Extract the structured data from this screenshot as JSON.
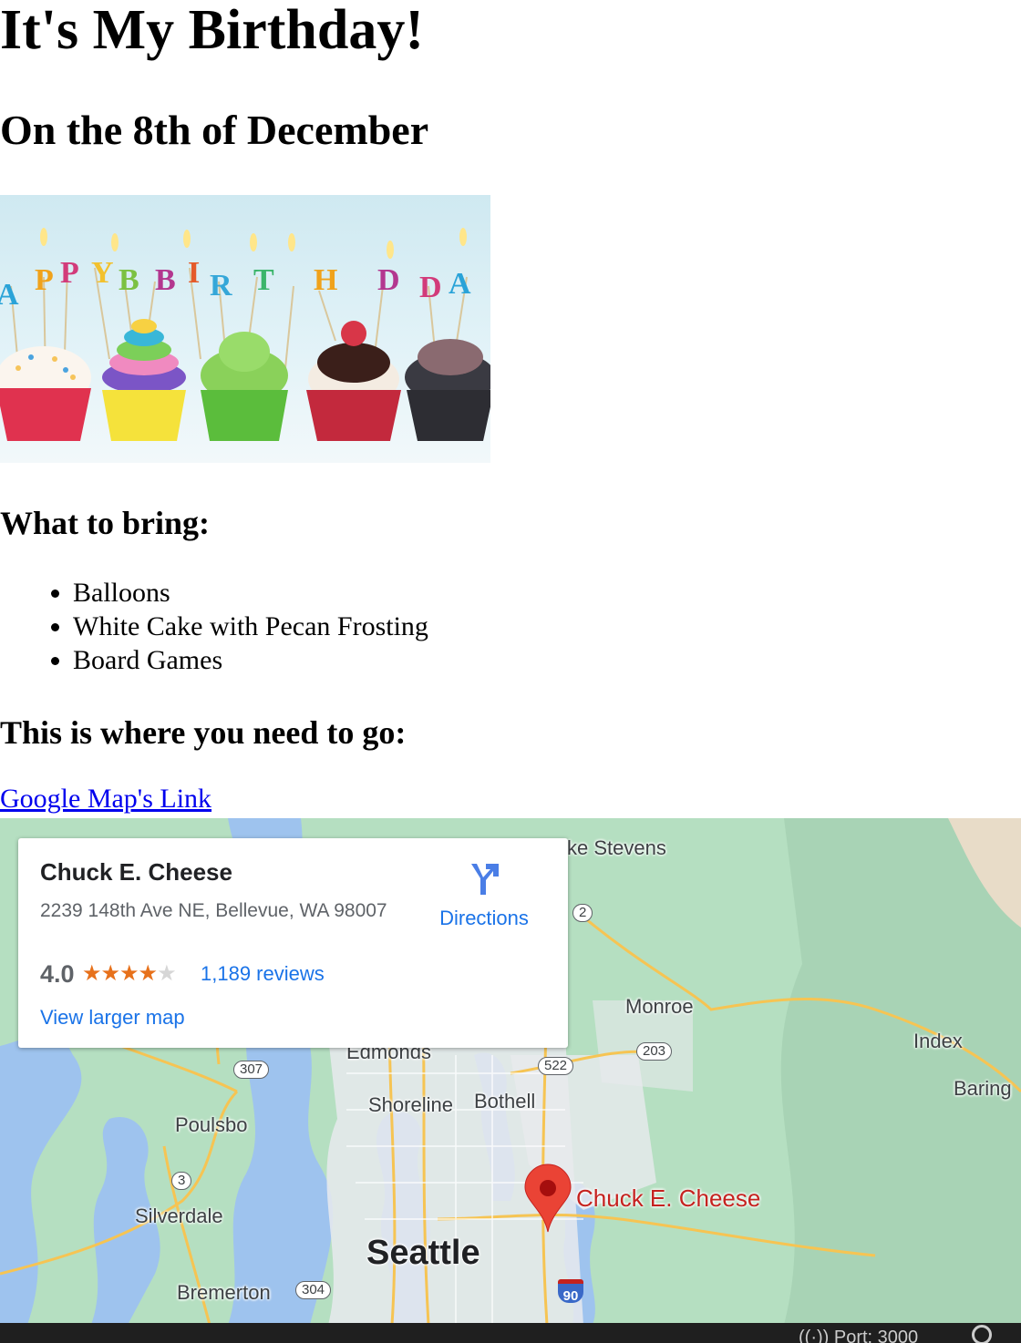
{
  "page": {
    "title": "It's My Birthday!",
    "date_heading": "On the 8th of December",
    "banner_text": "HAPPY BIRTHDAY",
    "bring_heading": "What to bring:",
    "bring_items": [
      "Balloons",
      "White Cake with Pecan Frosting",
      "Board Games"
    ],
    "where_heading": "This is where you need to go:",
    "map_link_label": "Google Map's Link"
  },
  "map_card": {
    "place_name": "Chuck E. Cheese",
    "address": "2239 148th Ave NE, Bellevue, WA 98007",
    "rating": "4.0",
    "stars_filled": 4,
    "stars_total": 5,
    "reviews": "1,189 reviews",
    "directions_label": "Directions",
    "view_larger": "View larger map",
    "directions_icon": "directions-arrow-icon",
    "star_color": "#e7711b",
    "link_color": "#1a73e8"
  },
  "map": {
    "cities": {
      "seattle": "Seattle",
      "monroe": "Monroe",
      "index": "Index",
      "baring": "Baring",
      "edmonds": "Edmonds",
      "shoreline": "Shoreline",
      "bothell": "Bothell",
      "poulsbo": "Poulsbo",
      "silverdale": "Silverdale",
      "bremerton": "Bremerton",
      "lake_stevens": "ke Stevens"
    },
    "poi_label": "Chuck E. Cheese",
    "marker_icon": "map-pin-icon",
    "routes": {
      "r2": "2",
      "r203": "203",
      "r522": "522",
      "r307": "307",
      "r3": "3",
      "r304": "304",
      "i90": "90"
    },
    "colors": {
      "land": "#b5dfc1",
      "water": "#9ec3ee",
      "urban": "#e8eaed",
      "roads": "#f6c453",
      "marker": "#ea4335"
    }
  },
  "statusbar": {
    "port_label": "Port: 3000",
    "port_icon": "broadcast-icon",
    "bell_icon": "notification-icon"
  }
}
